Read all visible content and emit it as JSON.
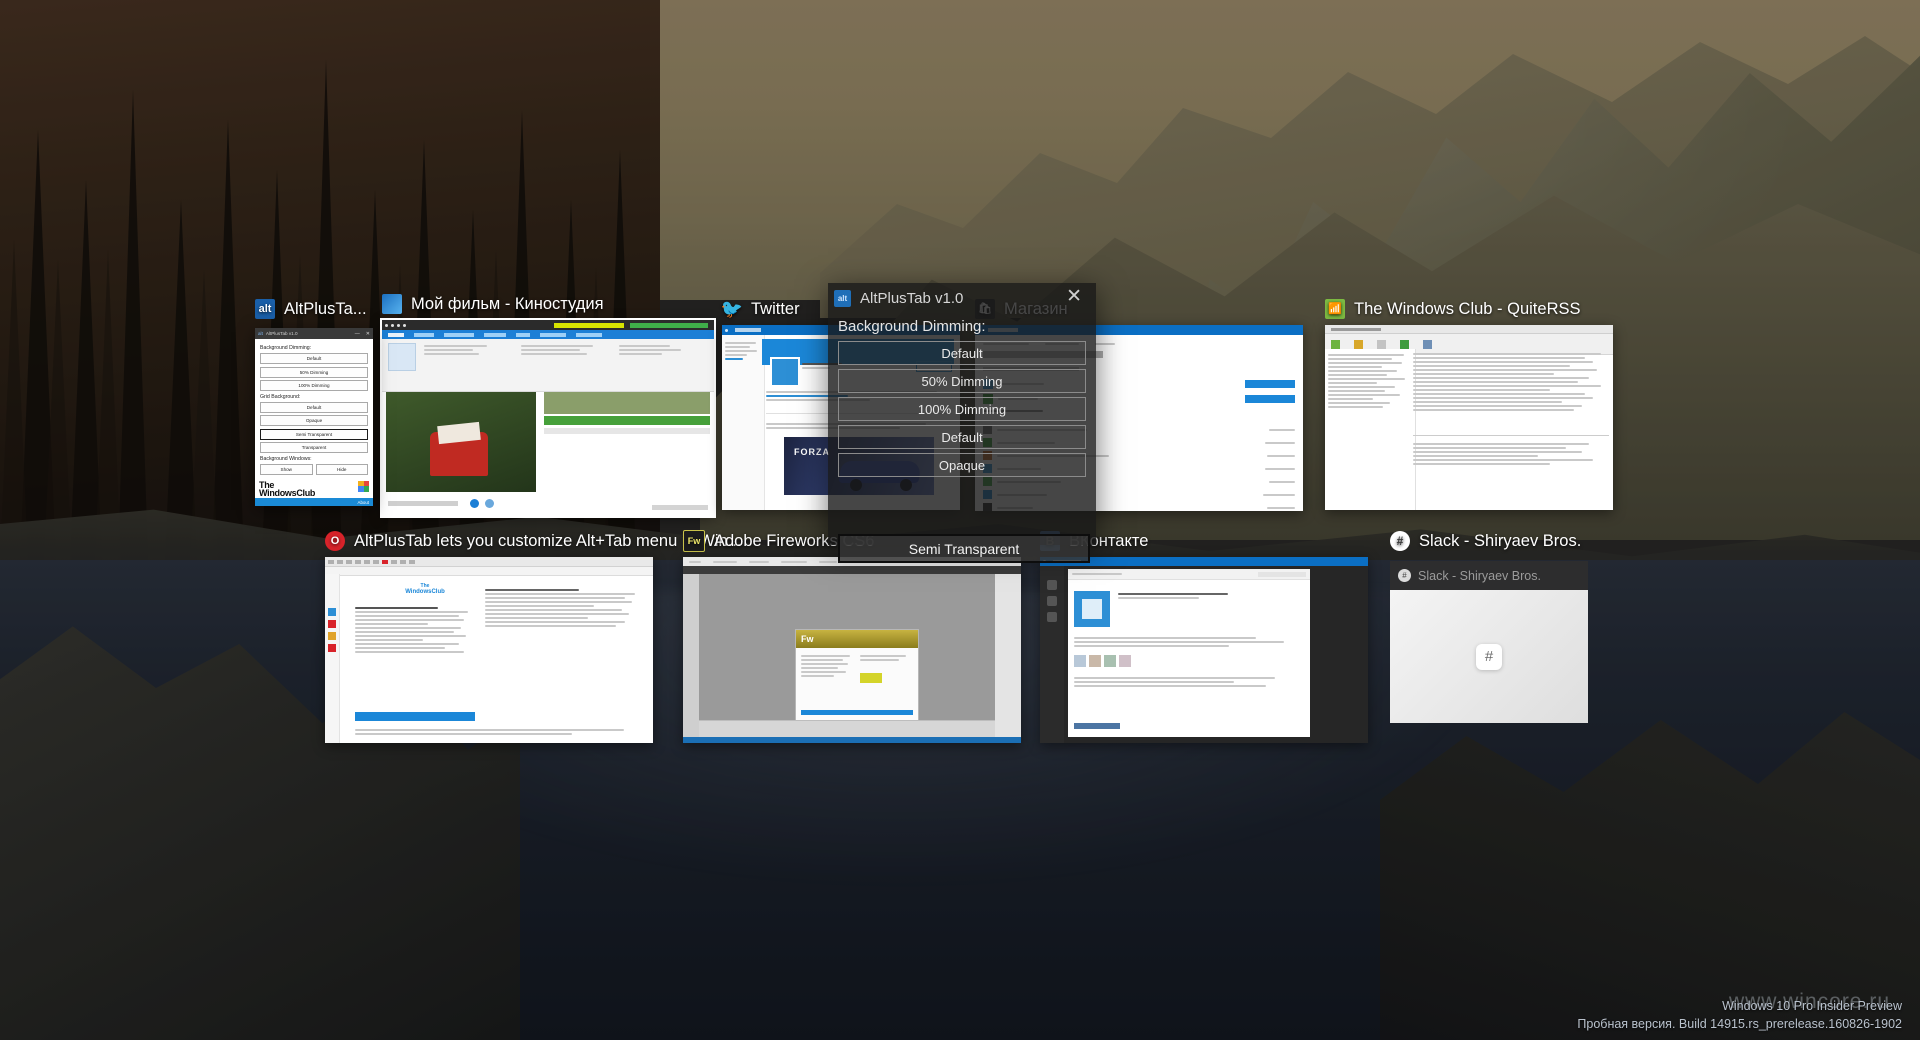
{
  "desktop": {
    "watermark": {
      "line1": "Windows 10 Pro Insider Preview",
      "line2": "Пробная версия. Build 14915.rs_prerelease.160826-1902",
      "site": "www.wincore.ru"
    }
  },
  "alt_tab": {
    "selected_index": 1,
    "tasks": [
      {
        "title": "AltPlusTa...",
        "icon_label": "alt",
        "icon_color": "#1a5fa8",
        "selected": false
      },
      {
        "title": "Мой фильм - Киностудия",
        "icon_label": "MM",
        "icon_color": "#1b6fc0",
        "selected": true
      },
      {
        "title": "Twitter",
        "icon_label": "t",
        "icon_color": "#1da1f2",
        "selected": false
      },
      {
        "title": "Магазин",
        "icon_label": "S",
        "icon_color": "#2a2a2a",
        "selected": false
      },
      {
        "title": "The Windows Club - QuiteRSS",
        "icon_label": "R",
        "icon_color": "#6cb33f",
        "selected": false
      },
      {
        "title": "AltPlusTab lets you customize Alt+Tab menu in Win...",
        "icon_label": "O",
        "icon_color": "#d8232a",
        "selected": false
      },
      {
        "title": "Adobe Fireworks CS6",
        "icon_label": "Fw",
        "icon_color": "#1c1c1c",
        "selected": false
      },
      {
        "title": "ВКонтакте",
        "icon_label": "В",
        "icon_color": "#4c75a3",
        "selected": false
      },
      {
        "title": "Slack - Shiryaev Bros.",
        "icon_label": "#",
        "icon_color": "#ffffff",
        "selected": false
      }
    ]
  },
  "slack_thumb": {
    "title": "Slack - Shiryaev Bros."
  },
  "altplustab_panel": {
    "window_title": "AltPlusTab v1.0",
    "minimize": "—",
    "close": "✕",
    "dimming_label": "Background Dimming:",
    "dimming_options": [
      "Default",
      "50% Dimming",
      "100% Dimming"
    ],
    "grid_label": "Grid Background:",
    "grid_options": [
      "Default",
      "Opaque",
      "Semi Transparent",
      "Transparent"
    ],
    "grid_selected": "Semi Transparent",
    "bgwin_label": "Background Windows:",
    "bgwin_options": [
      "Show",
      "Hide"
    ],
    "brand_line1": "The",
    "brand_line2": "WindowsClub",
    "about_label": "About"
  },
  "overlay_dialog": {
    "title": "AltPlusTab v1.0",
    "icon_label": "alt",
    "close_label": "✕",
    "heading": "Background Dimming:",
    "buttons": [
      "Default",
      "50% Dimming",
      "100% Dimming",
      "Default",
      "Opaque"
    ],
    "semi_transparent_label": "Semi Transparent"
  },
  "colors": {
    "accent": "#0b6fc4",
    "selection_outline": "#ffffff",
    "twc_blue": "#1a8ad6"
  }
}
